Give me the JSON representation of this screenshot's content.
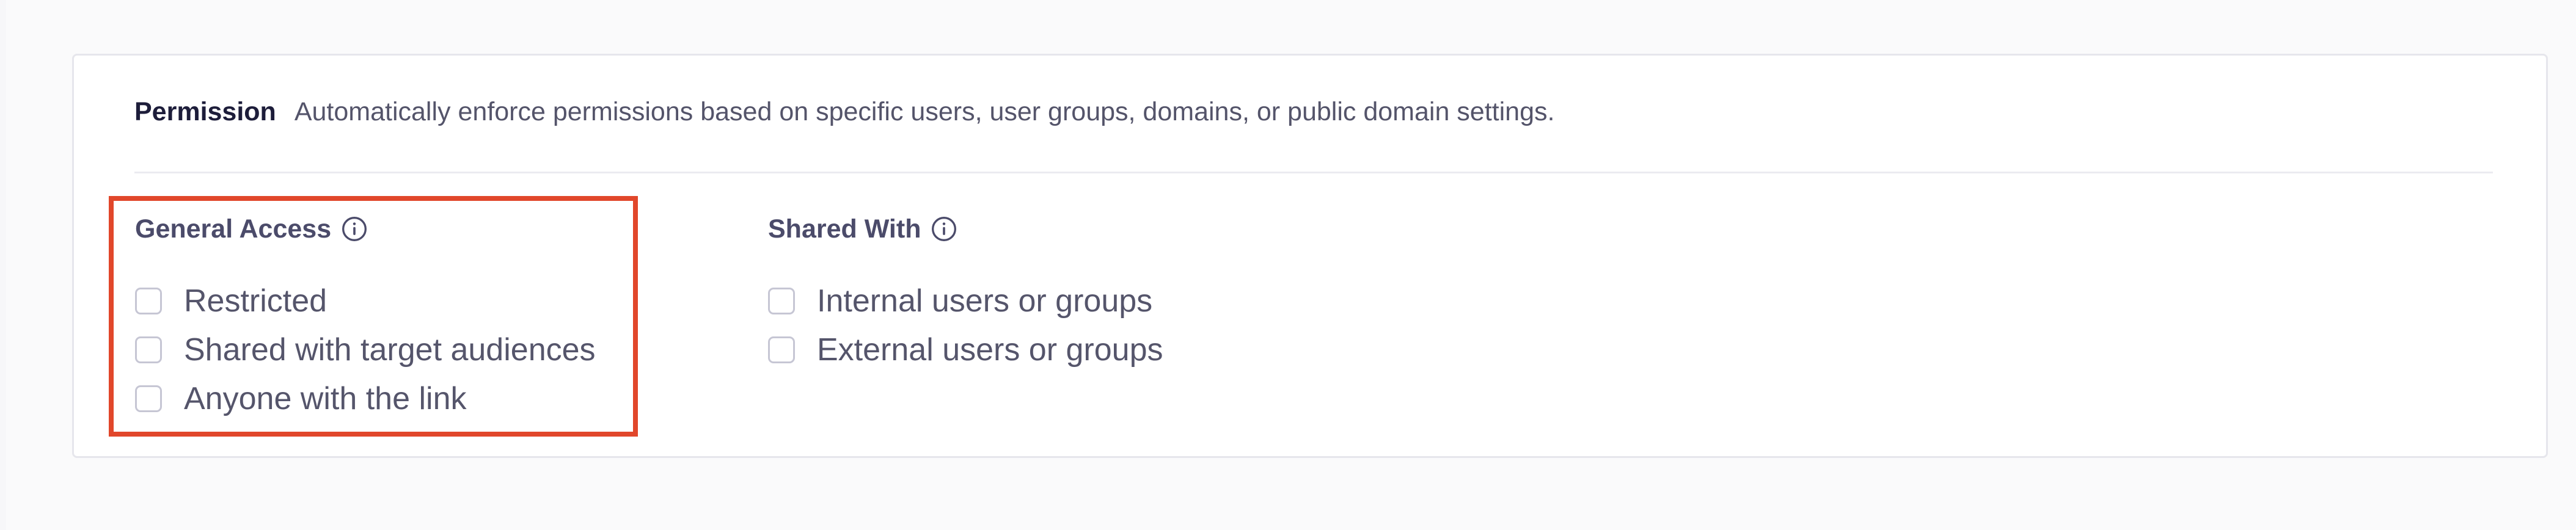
{
  "permission": {
    "title": "Permission",
    "description": "Automatically enforce permissions based on specific users, user groups, domains, or public domain settings."
  },
  "general_access": {
    "title": "General Access",
    "options": [
      {
        "label": "Restricted",
        "checked": false
      },
      {
        "label": "Shared with target audiences",
        "checked": false
      },
      {
        "label": "Anyone with the link",
        "checked": false
      }
    ]
  },
  "shared_with": {
    "title": "Shared With",
    "options": [
      {
        "label": "Internal users or groups",
        "checked": false
      },
      {
        "label": "External users or groups",
        "checked": false
      }
    ]
  },
  "colors": {
    "highlight": "#e1472b",
    "title_text": "#1d1d3a",
    "label_text": "#55556b",
    "checkbox_border": "#c6c6d4"
  }
}
